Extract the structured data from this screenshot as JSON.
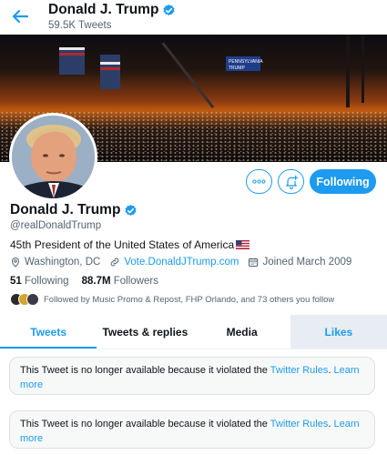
{
  "header": {
    "name": "Donald J. Trump",
    "tweet_count": "59.5K Tweets",
    "back_icon": "arrow-left-icon"
  },
  "banner": {
    "signs": [
      "PENNSYLVANIA",
      "TRUMP"
    ]
  },
  "profile": {
    "display_name": "Donald J. Trump",
    "handle": "@realDonaldTrump",
    "verified": true,
    "bio": "45th President of the United States of America",
    "location": "Washington, DC",
    "website": "Vote.DonaldJTrump.com",
    "joined": "Joined March 2009",
    "following_count": "51",
    "following_label": "Following",
    "followers_count": "88.7M",
    "followers_label": "Followers",
    "followed_by": "Followed by Music Promo & Repost, FHP Orlando, and 73 others you follow"
  },
  "actions": {
    "more_icon": "more-icon",
    "notify_icon": "bell-plus-icon",
    "following_label": "Following"
  },
  "tabs": [
    {
      "label": "Tweets",
      "active": true
    },
    {
      "label": "Tweets & replies",
      "active": false
    },
    {
      "label": "Media",
      "active": false
    },
    {
      "label": "Likes",
      "active": false
    }
  ],
  "notices": [
    {
      "text": "This Tweet is no longer available because it violated the ",
      "link": "Twitter Rules",
      "more": "Learn more"
    },
    {
      "text": "This Tweet is no longer available because it violated the ",
      "link": "Twitter Rules",
      "more": "Learn more"
    }
  ],
  "colors": {
    "accent": "#1d9bf0",
    "text": "#0f1419",
    "secondary": "#536471"
  }
}
